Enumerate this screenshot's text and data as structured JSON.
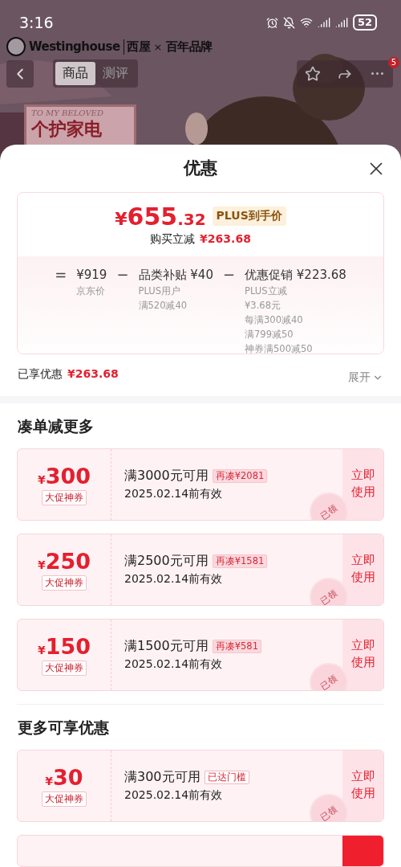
{
  "status_bar": {
    "time": "3:16",
    "battery": "52"
  },
  "header": {
    "brand": "Westinghouse",
    "brand_cn": "西屋",
    "brand_tag": "百年品牌",
    "cross": "×",
    "tabs": [
      {
        "label": "商品",
        "selected": true
      },
      {
        "label": "测评",
        "selected": false
      }
    ],
    "badge": "5",
    "poster_text": "TO MY BELOVED",
    "poster_title": "个护家电"
  },
  "sheet": {
    "title": "优惠",
    "summary": {
      "currency": "¥",
      "price_int": "655",
      "price_dec": ".32",
      "price_tag": "PLUS到手价",
      "saving_label": "购买立减",
      "saving": "¥263.68",
      "equation": [
        {
          "kind": "op",
          "text": "="
        },
        {
          "kind": "term",
          "amount": "¥919",
          "notes": [
            "京东价"
          ]
        },
        {
          "kind": "op",
          "text": "−"
        },
        {
          "kind": "term",
          "title": "品类补贴",
          "amount": "¥40",
          "notes": [
            "PLUS用户",
            "满520减40"
          ]
        },
        {
          "kind": "op",
          "text": "−"
        },
        {
          "kind": "term",
          "title": "优惠促销",
          "amount": "¥223.68",
          "notes": [
            "PLUS立减",
            "¥3.68元",
            "每满300减40",
            "满799减50",
            "神券满500减50"
          ]
        }
      ]
    },
    "enjoyed_label": "已享优惠",
    "enjoyed": "¥263.68",
    "expand": "展开",
    "sections": [
      {
        "title": "凑单减更多",
        "coupons": [
          {
            "currency": "¥",
            "amount": "300",
            "label": "大促神券",
            "condition": "满3000元可用",
            "tag": "再凑¥2081",
            "reached": false,
            "validity": "2025.02.14前有效",
            "action": "立即使用",
            "stamp": "已领"
          },
          {
            "currency": "¥",
            "amount": "250",
            "label": "大促神券",
            "condition": "满2500元可用",
            "tag": "再凑¥1581",
            "reached": false,
            "validity": "2025.02.14前有效",
            "action": "立即使用",
            "stamp": "已领"
          },
          {
            "currency": "¥",
            "amount": "150",
            "label": "大促神券",
            "condition": "满1500元可用",
            "tag": "再凑¥581",
            "reached": false,
            "validity": "2025.02.14前有效",
            "action": "立即使用",
            "stamp": "已领"
          }
        ]
      },
      {
        "title": "更多可享优惠",
        "coupons": [
          {
            "currency": "¥",
            "amount": "30",
            "label": "大促神券",
            "condition": "满300元可用",
            "tag": "已达门槛",
            "reached": true,
            "validity": "2025.02.14前有效",
            "action": "立即使用",
            "stamp": "已领"
          }
        ]
      }
    ]
  }
}
